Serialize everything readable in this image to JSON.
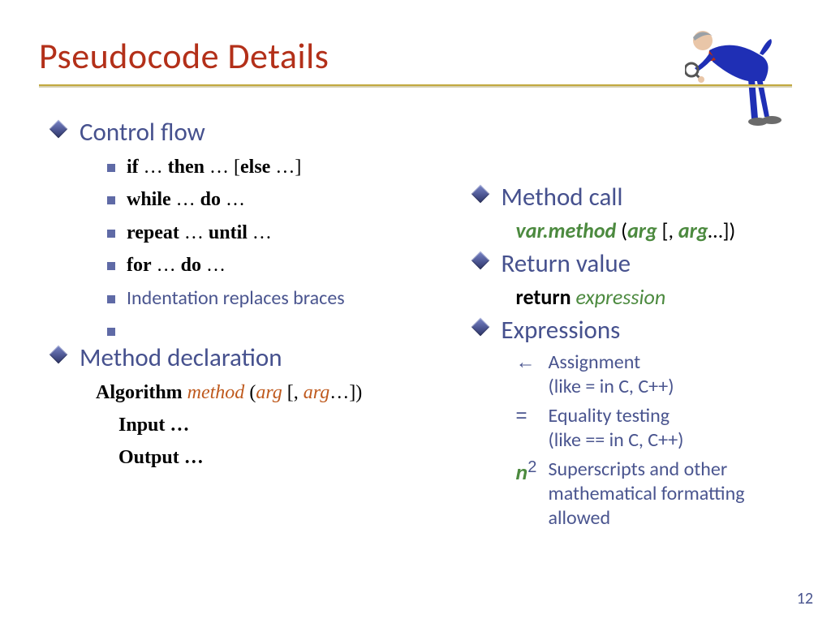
{
  "title": "Pseudocode Details",
  "page_number": "12",
  "left": {
    "control_flow": "Control flow",
    "items": [
      {
        "html": "<span class='bold'>if</span> … <span class='bold'>then</span> … [<span class='bold'>else</span> …]"
      },
      {
        "html": "<span class='bold'>while</span> … <span class='bold'>do</span> …"
      },
      {
        "html": "<span class='bold'>repeat</span> … <span class='bold'>until</span> …"
      },
      {
        "html": "<span class='bold'>for</span> … <span class='bold'>do</span> …"
      }
    ],
    "indentation": "Indentation replaces braces",
    "method_decl": "Method declaration",
    "algorithm_line": "<span class='bold'>Algorithm</span> <span class='orange-it'>method</span> (<span class='orange-it'>arg</span> [, <span class='orange-it'>arg</span>…])",
    "input": "Input …",
    "output": "Output …"
  },
  "right": {
    "method_call": "Method call",
    "method_call_line": "<span class='green-bold-it'>var.method</span> (<span class='green-bold-it'>arg</span> [, <span class='green-bold-it'>arg</span>…])",
    "return_value": "Return value",
    "return_line": "<span class='bold'>return</span> <span class='green-it'>expression</span>",
    "expressions": "Expressions",
    "expr": [
      {
        "sym": "←",
        "text": "Assignment<br>(like = in C, C++)"
      },
      {
        "sym": "=",
        "text": "Equality testing<br>(like == in C, C++)"
      },
      {
        "sym": "<span class='green-bold-it'>n</span><sup>2</sup>",
        "text": "Superscripts and other mathematical formatting allowed"
      }
    ]
  }
}
